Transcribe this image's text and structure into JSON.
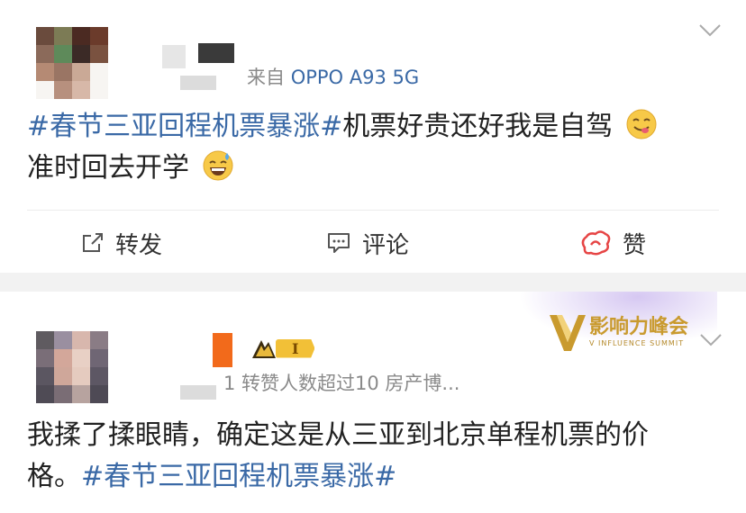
{
  "post1": {
    "source": "来自",
    "device": "OPPO A93 5G",
    "hashtag": "#春节三亚回程机票暴涨#",
    "body_line1": "机票好贵还好我是自驾",
    "body_line2": "准时回去开学",
    "actions": {
      "repost": "转发",
      "comment": "评论",
      "like": "赞"
    }
  },
  "post2": {
    "level_badge": "I",
    "meta": "1 转赞人数超过10  房产博...",
    "summit_title": "影响力峰会",
    "summit_sub": "V INFLUENCE SUMMIT",
    "body_line1": "我揉了揉眼睛，确定这是从三亚到北京单程机票的价",
    "body_line2_prefix": "格。",
    "hashtag": "#春节三亚回程机票暴涨#"
  },
  "colors": {
    "hashtag": "#3a69a6",
    "meta": "#8a8a8a",
    "divider": "#ececec",
    "summit_gold": "#c99a2e"
  },
  "icons": [
    "chevron-down-icon",
    "repost-icon",
    "comment-icon",
    "like-icon",
    "smile-tongue-emoji",
    "sweat-smile-emoji",
    "level-badge-icon"
  ]
}
